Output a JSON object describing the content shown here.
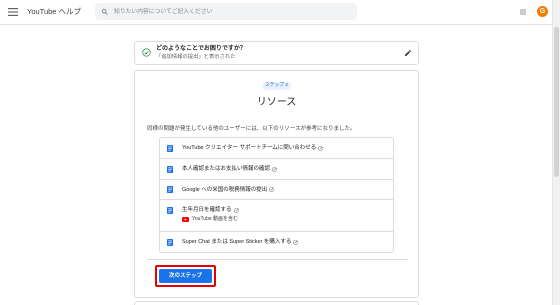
{
  "header": {
    "title": "YouTube ヘルプ",
    "search": {
      "placeholder": "知りたい内容についてご記入ください"
    },
    "avatar": {
      "letter": "G"
    }
  },
  "question_card": {
    "title": "どのようなことでお困りですか？",
    "answer": "「追加情報の提出」と表示された"
  },
  "step_card": {
    "badge": "ステップ 2",
    "heading": "リソース",
    "intro": "同様の問題が発生している他のユーザーには、以下のリソースが参考になりました。",
    "resources": [
      {
        "label": "YouTube クリエイター サポートチームに問い合わせる"
      },
      {
        "label": "本人確認またはお支払い情報の確認"
      },
      {
        "label": "Google への米国の税務情報の提出"
      },
      {
        "label": "生年月日を確認する",
        "sub": "YouTube 動画を含む"
      },
      {
        "label": "Super Chat または Super Sticker を購入する"
      }
    ],
    "next_button": "次のステップ"
  },
  "icons": {
    "menu": "menu-icon",
    "search": "search-icon",
    "apps": "apps-grid-icon",
    "status": "check-circle-icon",
    "edit": "pencil-icon",
    "resource": "article-icon",
    "external": "external-link-icon",
    "youtube": "youtube-play-icon"
  },
  "colors": {
    "accent": "#1a73e8",
    "check_green": "#1e8e3e",
    "highlight_red": "#e50000",
    "youtube_red": "#ff0000",
    "avatar_orange": "#f57c00",
    "badge_bg": "#e8f0fe",
    "badge_text": "#1967d2"
  }
}
